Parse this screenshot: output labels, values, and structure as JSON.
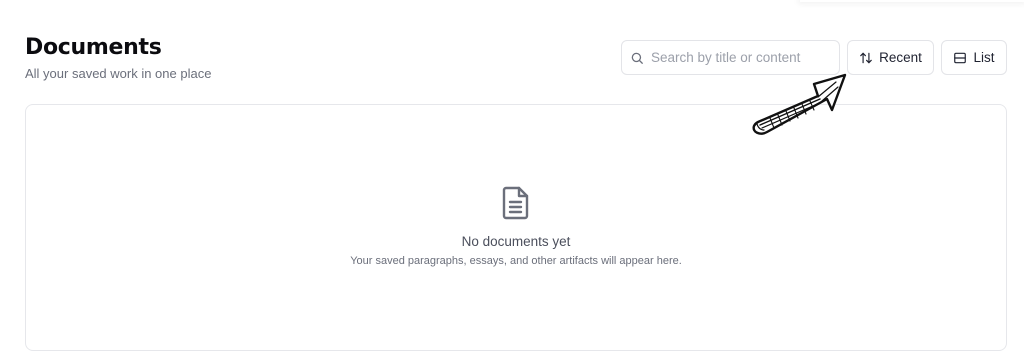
{
  "header": {
    "title": "Documents",
    "subtitle": "All your saved work in one place"
  },
  "search": {
    "placeholder": "Search by title or content",
    "value": "",
    "icon": "search-icon"
  },
  "toolbar": {
    "sort_label": "Recent",
    "sort_icon": "sort-arrows-icon",
    "view_label": "List",
    "view_icon": "list-view-icon"
  },
  "empty_state": {
    "icon": "document-icon",
    "title": "No documents yet",
    "description": "Your saved paragraphs, essays, and other artifacts will appear here."
  },
  "annotation": {
    "icon": "hand-drawn-arrow-icon"
  },
  "colors": {
    "border": "#e3e4e8",
    "text_primary": "#0b0b0f",
    "text_muted": "#6b6f7b",
    "icon_gray": "#6b6f7b"
  }
}
